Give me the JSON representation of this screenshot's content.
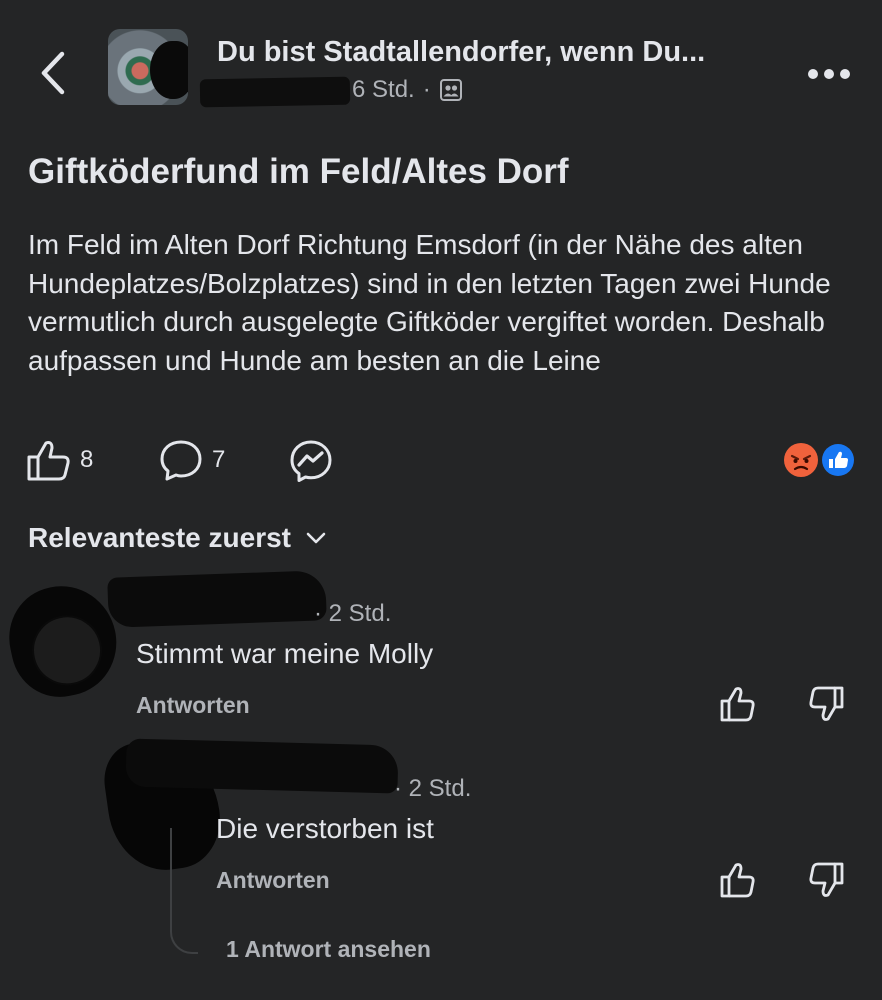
{
  "header": {
    "group_title": "Du bist Stadtallendorfer, wenn Du...",
    "time": "6 Std.",
    "separator": "·",
    "audience_icon": "group-members-icon"
  },
  "post": {
    "title": "Giftköderfund im Feld/Altes Dorf",
    "body": "Im Feld im Alten Dorf Richtung Emsdorf (in der Nähe des alten Hundeplatzes/Bolzplatzes) sind in den letzten Tagen zwei Hunde vermutlich durch ausgelegte Giftköder vergiftet worden. Deshalb aufpassen und Hunde am besten an die Leine",
    "like_count": "8",
    "comment_count": "7",
    "reactions": [
      "angry-reaction-icon",
      "like-reaction-icon"
    ]
  },
  "sort": {
    "label": "Relevanteste zuerst"
  },
  "comments": [
    {
      "time": "· 2 Std.",
      "text": "Stimmt war meine Molly",
      "reply_label": "Antworten"
    },
    {
      "time": "· 2 Std.",
      "text": "Die verstorben ist",
      "reply_label": "Antworten",
      "view_replies": "1 Antwort ansehen"
    }
  ],
  "colors": {
    "background": "#242526",
    "text_primary": "#e4e6eb",
    "text_secondary": "#b0b3b8",
    "like_blue": "#1877f2",
    "angry_orange": "#f0623c"
  }
}
